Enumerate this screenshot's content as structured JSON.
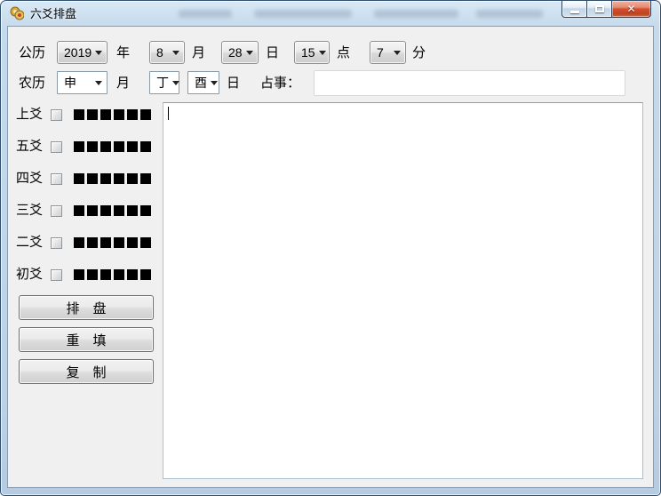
{
  "window": {
    "title": "六爻排盘",
    "icons": {
      "app_icon": "coins-icon",
      "dropdown_arrow": "▾",
      "close_glyph": "✕"
    }
  },
  "gregorian": {
    "row_label": "公历",
    "year": {
      "value": "2019",
      "unit": "年"
    },
    "month": {
      "value": "8",
      "unit": "月"
    },
    "day": {
      "value": "28",
      "unit": "日"
    },
    "hour": {
      "value": "15",
      "unit": "点"
    },
    "minute": {
      "value": "7",
      "unit": "分"
    }
  },
  "lunar": {
    "row_label": "农历",
    "month": {
      "value": "申",
      "unit": "月"
    },
    "day_stem": {
      "value": "丁"
    },
    "day_branch": {
      "value": "酉"
    },
    "day_unit": "日",
    "matter": {
      "label": "占事：",
      "value": ""
    }
  },
  "yao": {
    "rows": [
      {
        "label": "上爻",
        "checked": false,
        "squares": 6
      },
      {
        "label": "五爻",
        "checked": false,
        "squares": 6
      },
      {
        "label": "四爻",
        "checked": false,
        "squares": 6
      },
      {
        "label": "三爻",
        "checked": false,
        "squares": 6
      },
      {
        "label": "二爻",
        "checked": false,
        "squares": 6
      },
      {
        "label": "初爻",
        "checked": false,
        "squares": 6
      }
    ]
  },
  "actions": {
    "paipan": "排　盘",
    "chongtian": "重　填",
    "fuzhi": "复　制"
  },
  "result": {
    "value": ""
  }
}
